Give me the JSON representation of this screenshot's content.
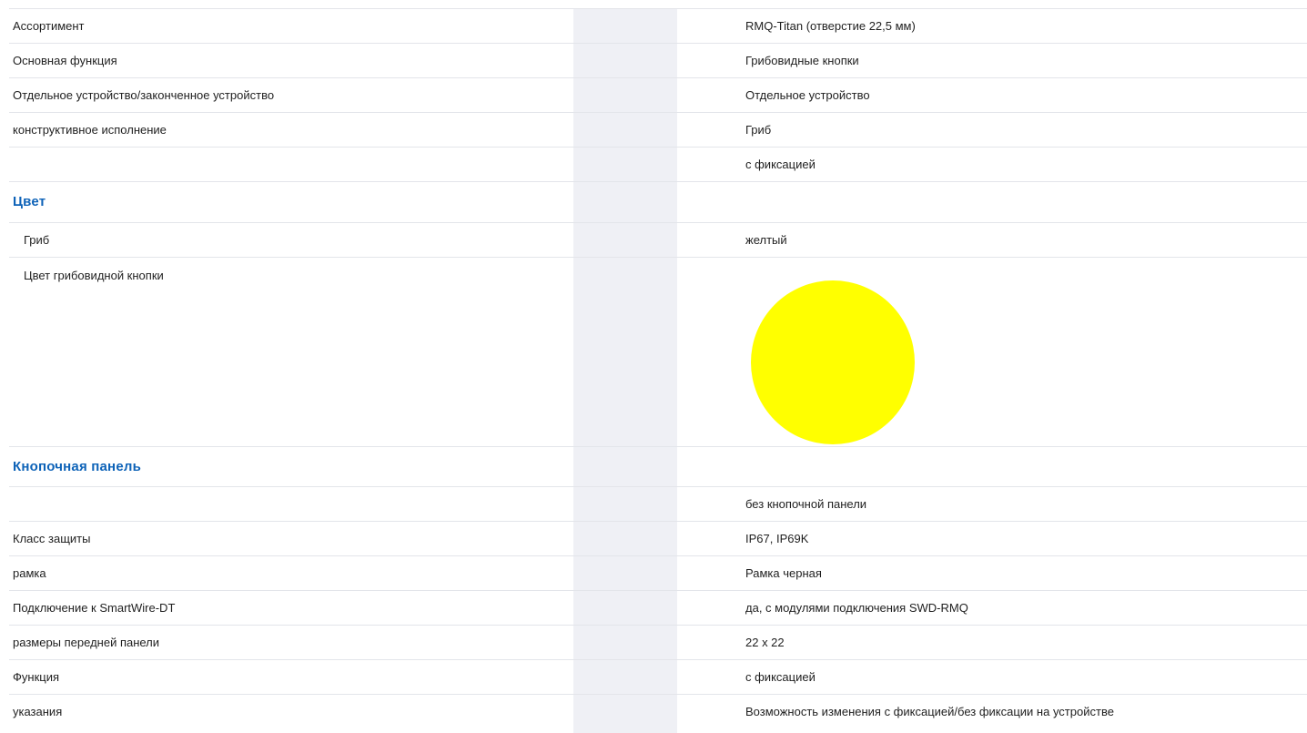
{
  "rows": [
    {
      "type": "row",
      "label": "Ассортимент",
      "value": "RMQ-Titan (отверстие 22,5 мм)"
    },
    {
      "type": "row",
      "label": "Основная функция",
      "value": "Грибовидные кнопки"
    },
    {
      "type": "row",
      "label": "Отдельное устройство/законченное устройство",
      "value": "Отдельное устройство"
    },
    {
      "type": "row",
      "label": "конструктивное исполнение",
      "value": "Гриб"
    },
    {
      "type": "row",
      "label": "",
      "value": "с фиксацией"
    },
    {
      "type": "section",
      "label": "Цвет"
    },
    {
      "type": "subrow",
      "label": "Гриб",
      "value": "желтый"
    },
    {
      "type": "swatch",
      "label": "Цвет грибовидной кнопки",
      "color": "#ffff00"
    },
    {
      "type": "section",
      "label": "Кнопочная панель"
    },
    {
      "type": "row",
      "label": "",
      "value": "без кнопочной панели"
    },
    {
      "type": "row",
      "label": "Класс защиты",
      "value": "IP67, IP69K"
    },
    {
      "type": "row",
      "label": "рамка",
      "value": "Рамка черная"
    },
    {
      "type": "row",
      "label": "Подключение к SmartWire-DT",
      "value": "да, с модулями подключения SWD-RMQ"
    },
    {
      "type": "row",
      "label": "размеры передней панели",
      "value": "22 x 22"
    },
    {
      "type": "row",
      "label": "Функция",
      "value": "с фиксацией"
    },
    {
      "type": "row",
      "label": "указания",
      "value": "Возможность изменения с фиксацией/без фиксации на устройстве"
    }
  ],
  "theme": {
    "heading_color": "#0e63b8",
    "band_color": "#eff0f5",
    "divider_color": "#e3e5ea"
  }
}
